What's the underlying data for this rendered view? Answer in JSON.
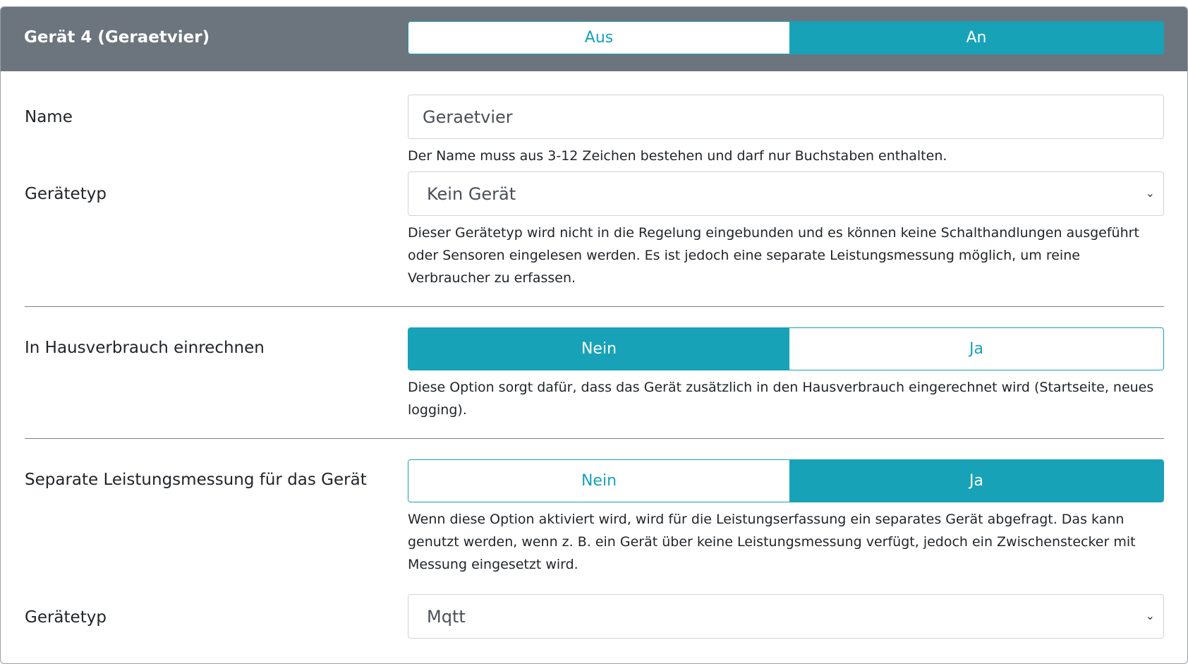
{
  "header": {
    "title": "Gerät 4 (Geraetvier)",
    "toggle": {
      "off": "Aus",
      "on": "An",
      "selected": "An"
    }
  },
  "name": {
    "label": "Name",
    "value": "Geraetvier",
    "help": "Der Name muss aus 3-12 Zeichen bestehen und darf nur Buchstaben enthalten."
  },
  "type": {
    "label": "Gerätetyp",
    "value": "Kein Gerät",
    "help": "Dieser Gerätetyp wird nicht in die Regelung eingebunden und es können keine Schalthandlungen ausgeführt oder Sensoren eingelesen werden. Es ist jedoch eine separate Leistungsmessung möglich, um reine Verbraucher zu erfassen."
  },
  "house": {
    "label": "In Hausverbrauch einrechnen",
    "no": "Nein",
    "yes": "Ja",
    "selected": "Nein",
    "help": "Diese Option sorgt dafür, dass das Gerät zusätzlich in den Hausverbrauch eingerechnet wird (Startseite, neues logging)."
  },
  "separate": {
    "label": "Separate Leistungsmessung für das Gerät",
    "no": "Nein",
    "yes": "Ja",
    "selected": "Ja",
    "help": "Wenn diese Option aktiviert wird, wird für die Leistungserfassung ein separates Gerät abgefragt. Das kann genutzt werden, wenn z. B. ein Gerät über keine Leistungsmessung verfügt, jedoch ein Zwischenstecker mit Messung eingesetzt wird."
  },
  "meter_type": {
    "label": "Gerätetyp",
    "value": "Mqtt"
  }
}
